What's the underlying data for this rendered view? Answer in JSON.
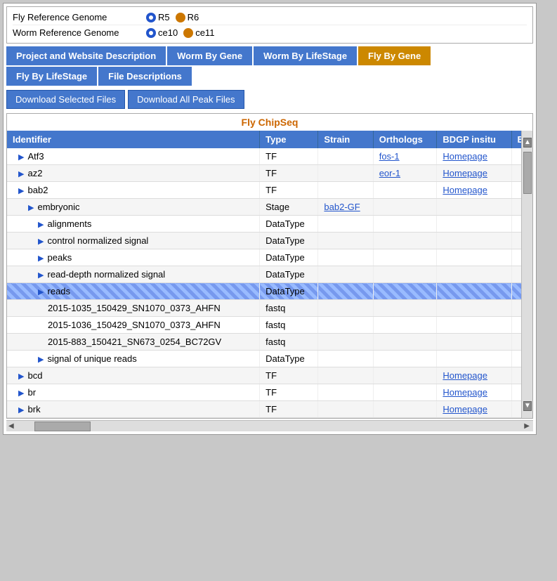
{
  "genome": {
    "fly": {
      "label": "Fly Reference Genome",
      "options": [
        {
          "id": "R5",
          "label": "R5",
          "selected": true,
          "color": "blue"
        },
        {
          "id": "R6",
          "label": "R6",
          "selected": false,
          "color": "orange"
        }
      ]
    },
    "worm": {
      "label": "Worm Reference Genome",
      "options": [
        {
          "id": "ce10",
          "label": "ce10",
          "selected": true,
          "color": "blue"
        },
        {
          "id": "ce11",
          "label": "ce11",
          "selected": false,
          "color": "orange"
        }
      ]
    }
  },
  "tabs_row1": [
    {
      "id": "project",
      "label": "Project and Website Description",
      "color": "blue"
    },
    {
      "id": "worm-gene",
      "label": "Worm By Gene",
      "color": "blue"
    },
    {
      "id": "worm-lifestage",
      "label": "Worm By LifeStage",
      "color": "blue"
    },
    {
      "id": "fly-gene",
      "label": "Fly By Gene",
      "color": "orange"
    }
  ],
  "tabs_row2": [
    {
      "id": "fly-lifestage",
      "label": "Fly By LifeStage",
      "color": "blue"
    },
    {
      "id": "file-desc",
      "label": "File Descriptions",
      "color": "blue"
    }
  ],
  "actions": [
    {
      "id": "download-selected",
      "label": "Download Selected Files"
    },
    {
      "id": "download-all",
      "label": "Download All Peak Files"
    }
  ],
  "table": {
    "title": "Fly ChipSeq",
    "columns": [
      "Identifier",
      "Type",
      "Strain",
      "Orthologs",
      "BDGP insitu",
      "E"
    ],
    "rows": [
      {
        "indent": 1,
        "arrow": true,
        "identifier": "Atf3",
        "type": "TF",
        "strain": "",
        "orthologs": "fos-1",
        "bdgp": "Homepage",
        "e": "",
        "highlighted": false
      },
      {
        "indent": 1,
        "arrow": true,
        "identifier": "az2",
        "type": "TF",
        "strain": "",
        "orthologs": "eor-1",
        "bdgp": "Homepage",
        "e": "",
        "highlighted": false
      },
      {
        "indent": 1,
        "arrow": true,
        "identifier": "bab2",
        "type": "TF",
        "strain": "",
        "orthologs": "",
        "bdgp": "Homepage",
        "e": "",
        "highlighted": false
      },
      {
        "indent": 2,
        "arrow": true,
        "identifier": "embryonic",
        "type": "Stage",
        "strain": "bab2-GF",
        "orthologs": "",
        "bdgp": "",
        "e": "",
        "highlighted": false
      },
      {
        "indent": 3,
        "arrow": true,
        "identifier": "alignments",
        "type": "DataType",
        "strain": "",
        "orthologs": "",
        "bdgp": "",
        "e": "",
        "highlighted": false
      },
      {
        "indent": 3,
        "arrow": true,
        "identifier": "control normalized signal",
        "type": "DataType",
        "strain": "",
        "orthologs": "",
        "bdgp": "",
        "e": "",
        "highlighted": false
      },
      {
        "indent": 3,
        "arrow": true,
        "identifier": "peaks",
        "type": "DataType",
        "strain": "",
        "orthologs": "",
        "bdgp": "",
        "e": "",
        "highlighted": false
      },
      {
        "indent": 3,
        "arrow": true,
        "identifier": "read-depth normalized signal",
        "type": "DataType",
        "strain": "",
        "orthologs": "",
        "bdgp": "",
        "e": "",
        "highlighted": false
      },
      {
        "indent": 3,
        "arrow": true,
        "identifier": "reads",
        "type": "DataType",
        "strain": "",
        "orthologs": "",
        "bdgp": "",
        "e": "",
        "highlighted": true,
        "striped": true
      },
      {
        "indent": 4,
        "arrow": false,
        "identifier": "2015-1035_150429_SN1070_0373_AHFN",
        "type": "fastq",
        "strain": "",
        "orthologs": "",
        "bdgp": "",
        "e": "",
        "highlighted": false
      },
      {
        "indent": 4,
        "arrow": false,
        "identifier": "2015-1036_150429_SN1070_0373_AHFN",
        "type": "fastq",
        "strain": "",
        "orthologs": "",
        "bdgp": "",
        "e": "",
        "highlighted": false
      },
      {
        "indent": 4,
        "arrow": false,
        "identifier": "2015-883_150421_SN673_0254_BC72GV",
        "type": "fastq",
        "strain": "",
        "orthologs": "",
        "bdgp": "",
        "e": "",
        "highlighted": false
      },
      {
        "indent": 3,
        "arrow": true,
        "identifier": "signal of unique reads",
        "type": "DataType",
        "strain": "",
        "orthologs": "",
        "bdgp": "",
        "e": "",
        "highlighted": false
      },
      {
        "indent": 1,
        "arrow": true,
        "identifier": "bcd",
        "type": "TF",
        "strain": "",
        "orthologs": "",
        "bdgp": "Homepage",
        "e": "",
        "highlighted": false
      },
      {
        "indent": 1,
        "arrow": true,
        "identifier": "br",
        "type": "TF",
        "strain": "",
        "orthologs": "",
        "bdgp": "Homepage",
        "e": "",
        "highlighted": false
      },
      {
        "indent": 1,
        "arrow": true,
        "identifier": "brk",
        "type": "TF",
        "strain": "",
        "orthologs": "",
        "bdgp": "Homepage",
        "e": "",
        "highlighted": false
      }
    ]
  }
}
